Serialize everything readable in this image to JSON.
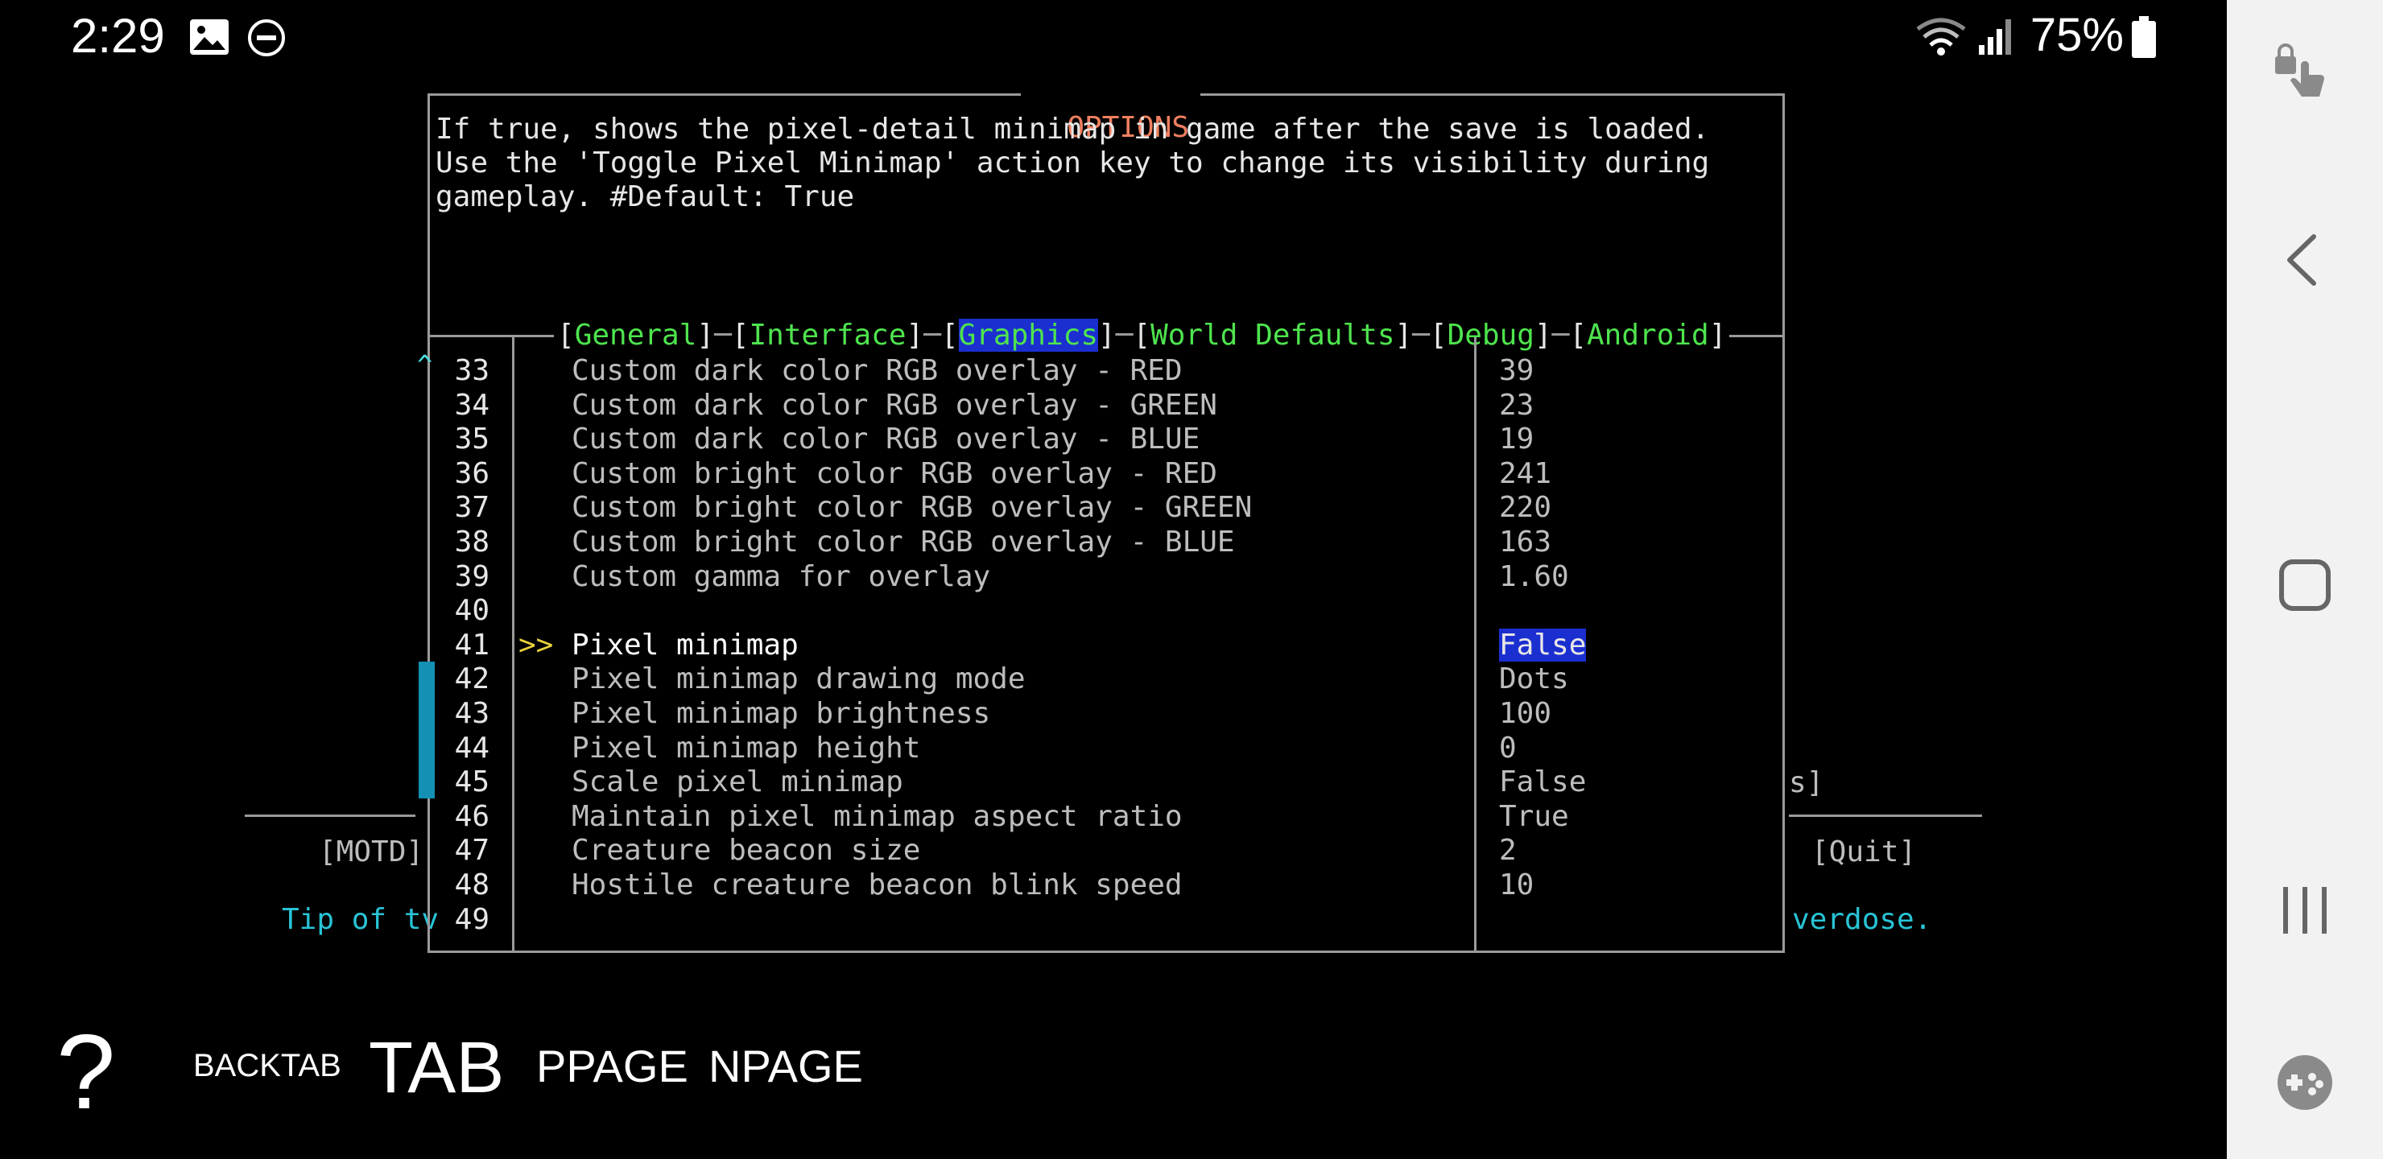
{
  "status_bar": {
    "time": "2:29",
    "battery": "75%",
    "icons": [
      "image-icon",
      "do-not-disturb-icon",
      "wifi-icon",
      "signal-icon",
      "battery-icon"
    ]
  },
  "options": {
    "title": "OPTIONS",
    "description": "If true, shows the pixel-detail minimap in game after the save is loaded.  Use the 'Toggle Pixel Minimap' action key to change its visibility during gameplay. #Default: True",
    "tabs": [
      {
        "label": "General",
        "active": false
      },
      {
        "label": "Interface",
        "active": false
      },
      {
        "label": "Graphics",
        "active": true
      },
      {
        "label": "World Defaults",
        "active": false
      },
      {
        "label": "Debug",
        "active": false
      },
      {
        "label": "Android",
        "active": false
      }
    ],
    "scroll_up": "^",
    "selected_marker": ">>",
    "rows": [
      {
        "num": "33",
        "label": "Custom dark color RGB overlay - RED",
        "value": "39"
      },
      {
        "num": "34",
        "label": "Custom dark color RGB overlay - GREEN",
        "value": "23"
      },
      {
        "num": "35",
        "label": "Custom dark color RGB overlay - BLUE",
        "value": "19"
      },
      {
        "num": "36",
        "label": "Custom bright color RGB overlay - RED",
        "value": "241"
      },
      {
        "num": "37",
        "label": "Custom bright color RGB overlay - GREEN",
        "value": "220"
      },
      {
        "num": "38",
        "label": "Custom bright color RGB overlay - BLUE",
        "value": "163"
      },
      {
        "num": "39",
        "label": "Custom gamma for overlay",
        "value": "1.60"
      },
      {
        "num": "40",
        "label": "",
        "value": ""
      },
      {
        "num": "41",
        "label": "Pixel minimap",
        "value": "False"
      },
      {
        "num": "42",
        "label": "Pixel minimap drawing mode",
        "value": "Dots"
      },
      {
        "num": "43",
        "label": "Pixel minimap brightness",
        "value": "100"
      },
      {
        "num": "44",
        "label": "Pixel minimap height",
        "value": "0"
      },
      {
        "num": "45",
        "label": "Scale pixel minimap",
        "value": "False"
      },
      {
        "num": "46",
        "label": "Maintain pixel minimap aspect ratio",
        "value": "True"
      },
      {
        "num": "47",
        "label": "Creature beacon size",
        "value": "2"
      },
      {
        "num": "48",
        "label": "Hostile creature beacon blink speed",
        "value": "10"
      },
      {
        "num": "49",
        "label": "",
        "value": ""
      }
    ]
  },
  "background": {
    "motd": "[MOTD]",
    "quit": "[Quit]",
    "fragment_s": "s]",
    "tip_left": "Tip of tv",
    "tip_right": "verdose."
  },
  "keys": {
    "help": "?",
    "backtab": "BACKTAB",
    "tab": "TAB",
    "ppage": "PPAGE",
    "npage": "NPAGE"
  },
  "colors": {
    "accent_blue": "#1b2fd0",
    "tab_green": "#4ee44e",
    "title_orange": "#f08060",
    "tip_cyan": "#28c4d6",
    "scroll_thumb": "#1390b4",
    "marker_yellow": "#e8d23a"
  }
}
